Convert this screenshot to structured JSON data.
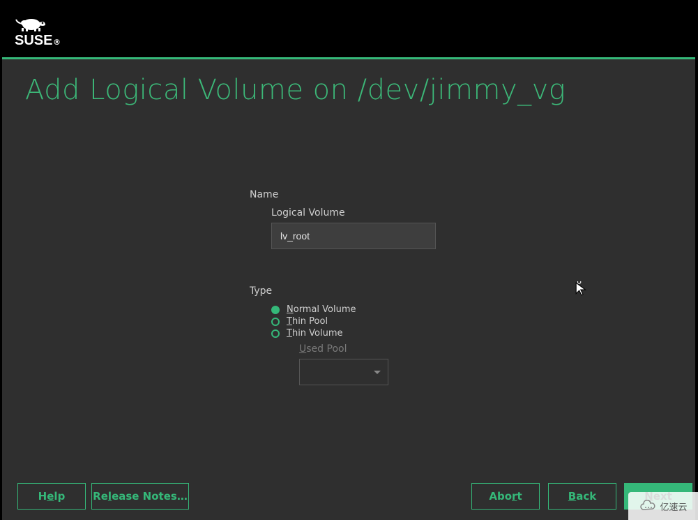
{
  "brand": {
    "name": "SUSE"
  },
  "page": {
    "title": "Add Logical Volume on /dev/jimmy_vg"
  },
  "form": {
    "name_section_label": "Name",
    "lv_label": "Logical Volume",
    "lv_value": "lv_root",
    "type_section_label": "Type",
    "radios": {
      "normal": "Normal Volume",
      "thin_pool": "Thin Pool",
      "thin_volume": "Thin Volume"
    },
    "used_pool_label_pre": "U",
    "used_pool_label_rest": "sed Pool",
    "used_pool_value": ""
  },
  "buttons": {
    "help_pre": "H",
    "help_u": "e",
    "help_post": "lp",
    "notes_pre": "Re",
    "notes_u": "l",
    "notes_post": "ease Notes…",
    "abort_pre": "Abo",
    "abort_u": "r",
    "abort_post": "t",
    "back_pre": "",
    "back_u": "B",
    "back_post": "ack",
    "next_pre": "",
    "next_u": "N",
    "next_post": "ext"
  },
  "watermark": {
    "text": "亿速云"
  }
}
